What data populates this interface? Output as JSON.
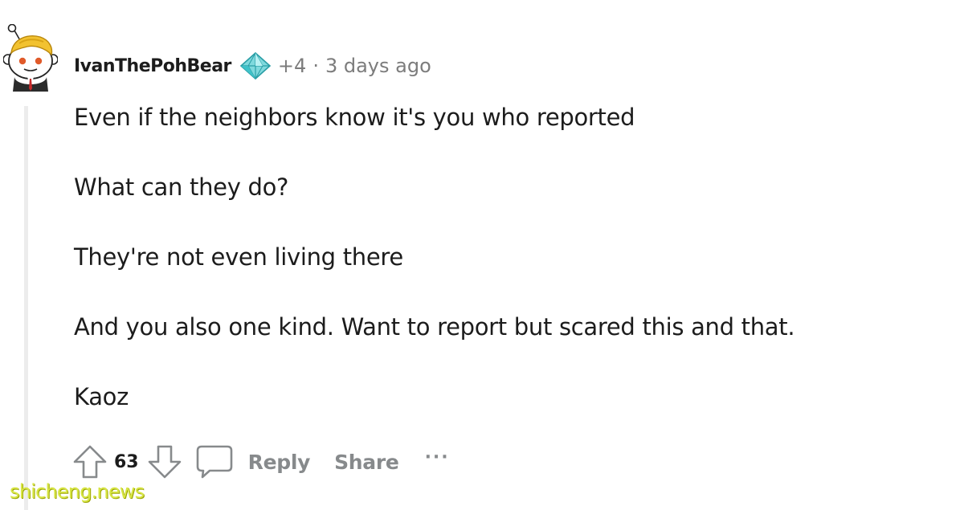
{
  "comment": {
    "username": "IvanThePohBear",
    "flair_icon": "diamond-award-icon",
    "karma": "+4",
    "separator": "·",
    "timestamp": "3 days ago",
    "paragraphs": [
      "Even if the neighbors know it's you who reported",
      "What can they do?",
      "They're not even living there",
      "And you also one kind. Want to report but scared this and that.",
      "Kaoz"
    ],
    "actions": {
      "upvote_icon": "upvote-arrow-icon",
      "vote_count": "63",
      "downvote_icon": "downvote-arrow-icon",
      "reply_icon": "speech-bubble-icon",
      "reply_label": "Reply",
      "share_label": "Share",
      "more_label": "···"
    }
  },
  "watermark": "shicheng.news",
  "colors": {
    "text": "#1c1c1c",
    "meta": "#7c7c7c",
    "action": "#878a8c",
    "thread_line": "#ececec",
    "flair_teal": "#3fc2c9",
    "watermark": "#d8e645"
  }
}
